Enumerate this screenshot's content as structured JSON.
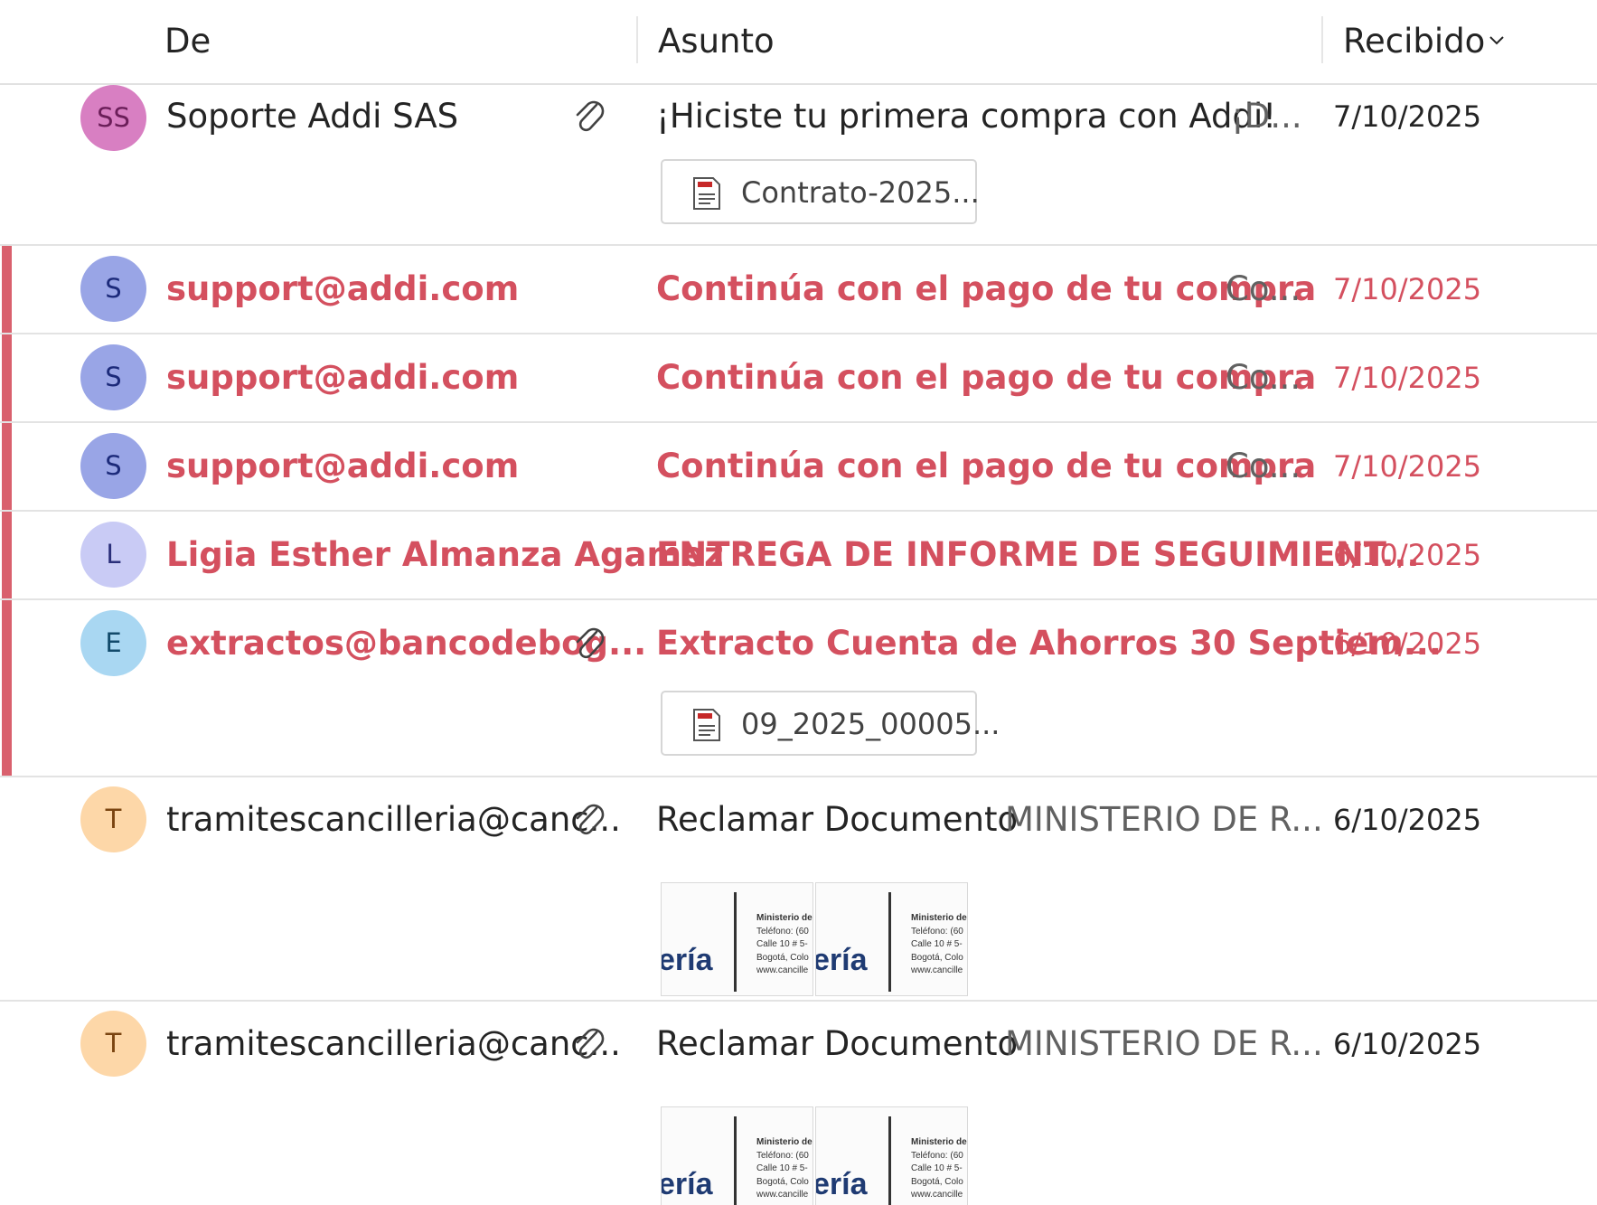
{
  "columns": {
    "from": "De",
    "subject": "Asunto",
    "received": "Recibido"
  },
  "colors": {
    "unread_accent": "#d9606d",
    "unread_text": "#d4505f",
    "preview_text": "#616161"
  },
  "emails": [
    {
      "initials": "SS",
      "sender": "Soporte Addi SAS",
      "subject": "¡Hiciste tu primera compra con Addi!",
      "preview": "¡D...",
      "date": "7/10/2025",
      "unread": false,
      "has_attachment": true,
      "attachment": "Contrato-2025...",
      "avatar_color": "#d87fc2"
    },
    {
      "initials": "S",
      "sender": "support@addi.com",
      "subject": "Continúa con el pago de tu compra",
      "preview": "Co...",
      "date": "7/10/2025",
      "unread": true,
      "avatar_color": "#99a5e6"
    },
    {
      "initials": "S",
      "sender": "support@addi.com",
      "subject": "Continúa con el pago de tu compra",
      "preview": "Co...",
      "date": "7/10/2025",
      "unread": true,
      "avatar_color": "#99a5e6"
    },
    {
      "initials": "S",
      "sender": "support@addi.com",
      "subject": "Continúa con el pago de tu compra",
      "preview": "Co...",
      "date": "7/10/2025",
      "unread": true,
      "avatar_color": "#99a5e6"
    },
    {
      "initials": "L",
      "sender": "Ligia Esther Almanza Agamez",
      "subject": "ENTREGA DE INFORME DE SEGUIMIENT...",
      "date": "6/10/2025",
      "unread": true,
      "avatar_color": "#c9cbf5"
    },
    {
      "initials": "E",
      "sender": "extractos@bancodebog...",
      "subject": "Extracto Cuenta de Ahorros 30 Septiem...",
      "date": "6/10/2025",
      "unread": true,
      "has_attachment": true,
      "attachment": "09_2025_00005...",
      "avatar_color": "#a9d7f2"
    },
    {
      "initials": "T",
      "sender": "tramitescancilleria@canc...",
      "subject": "Reclamar Documento",
      "preview": "MINISTERIO DE R...",
      "date": "6/10/2025",
      "unread": false,
      "has_attachment": true,
      "avatar_color": "#fdd7a8"
    },
    {
      "initials": "T",
      "sender": "tramitescancilleria@canc...",
      "subject": "Reclamar Documento",
      "preview": "MINISTERIO DE R...",
      "date": "6/10/2025",
      "unread": false,
      "has_attachment": true,
      "avatar_color": "#fdd7a8"
    }
  ],
  "thumbnail": {
    "logo_fragment": "ería",
    "lines": [
      "Ministerio de",
      "Teléfono: (60",
      "Calle 10 # 5-",
      "Bogotá, Colo",
      "www.cancille"
    ]
  }
}
